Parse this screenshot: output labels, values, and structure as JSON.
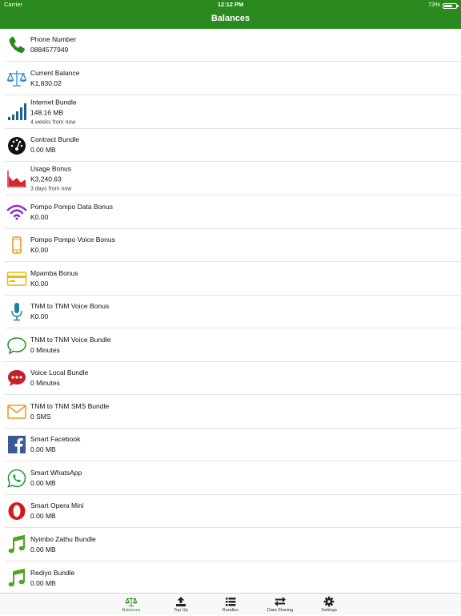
{
  "status_bar": {
    "carrier": "Carrier",
    "time": "12:12 PM",
    "battery": "73%",
    "battery_level": 0.73
  },
  "header": {
    "title": "Balances"
  },
  "colors": {
    "brand": "#2b8a1f"
  },
  "items": [
    {
      "icon": "phone-icon",
      "name": "Phone Number",
      "value": "0884577949",
      "expiry": ""
    },
    {
      "icon": "scale-icon",
      "name": "Current Balance",
      "value": "K1,830.02",
      "expiry": ""
    },
    {
      "icon": "signal-bars-icon",
      "name": "Internet Bundle",
      "value": "148.16 MB",
      "expiry": "4 weeks from now"
    },
    {
      "icon": "gauge-icon",
      "name": "Contract Bundle",
      "value": "0.00 MB",
      "expiry": ""
    },
    {
      "icon": "area-chart-icon",
      "name": "Usage Bonus",
      "value": "K3,240.63",
      "expiry": "3 days from now"
    },
    {
      "icon": "wifi-icon",
      "name": "Pompo Pompo Data Bonus",
      "value": "K0.00",
      "expiry": ""
    },
    {
      "icon": "mobile-phone-icon",
      "name": "Pompo Pompo Voice Bonus",
      "value": "K0.00",
      "expiry": ""
    },
    {
      "icon": "credit-card-icon",
      "name": "Mpamba Bonus",
      "value": "K0.00",
      "expiry": ""
    },
    {
      "icon": "microphone-icon",
      "name": "TNM to TNM Voice Bonus",
      "value": "K0.00",
      "expiry": ""
    },
    {
      "icon": "speech-bubble-icon",
      "name": "TNM to TNM Voice Bundle",
      "value": "0 Minutes",
      "expiry": ""
    },
    {
      "icon": "chat-dots-icon",
      "name": "Voice Local Bundle",
      "value": "0 Minutes",
      "expiry": ""
    },
    {
      "icon": "envelope-icon",
      "name": "TNM to TNM SMS Bundle",
      "value": "0 SMS",
      "expiry": ""
    },
    {
      "icon": "facebook-icon",
      "name": "Smart Facebook",
      "value": "0.00 MB",
      "expiry": ""
    },
    {
      "icon": "whatsapp-icon",
      "name": "Smart WhatsApp",
      "value": "0.00 MB",
      "expiry": ""
    },
    {
      "icon": "opera-icon",
      "name": "Smart Opera Mini",
      "value": "0.00 MB",
      "expiry": ""
    },
    {
      "icon": "music-note-icon",
      "name": "Nyimbo Zathu Bundle",
      "value": "0.00 MB",
      "expiry": ""
    },
    {
      "icon": "music-note-icon",
      "name": "Rediyo Bundle",
      "value": "0.00 MB",
      "expiry": ""
    }
  ],
  "tabs": [
    {
      "icon": "scale-icon",
      "label": "Balances",
      "active": true
    },
    {
      "icon": "upload-icon",
      "label": "Top Up",
      "active": false
    },
    {
      "icon": "list-icon",
      "label": "Bundles",
      "active": false
    },
    {
      "icon": "transfer-arrows-icon",
      "label": "Data Sharing",
      "active": false
    },
    {
      "icon": "gear-icon",
      "label": "Settings",
      "active": false
    }
  ]
}
